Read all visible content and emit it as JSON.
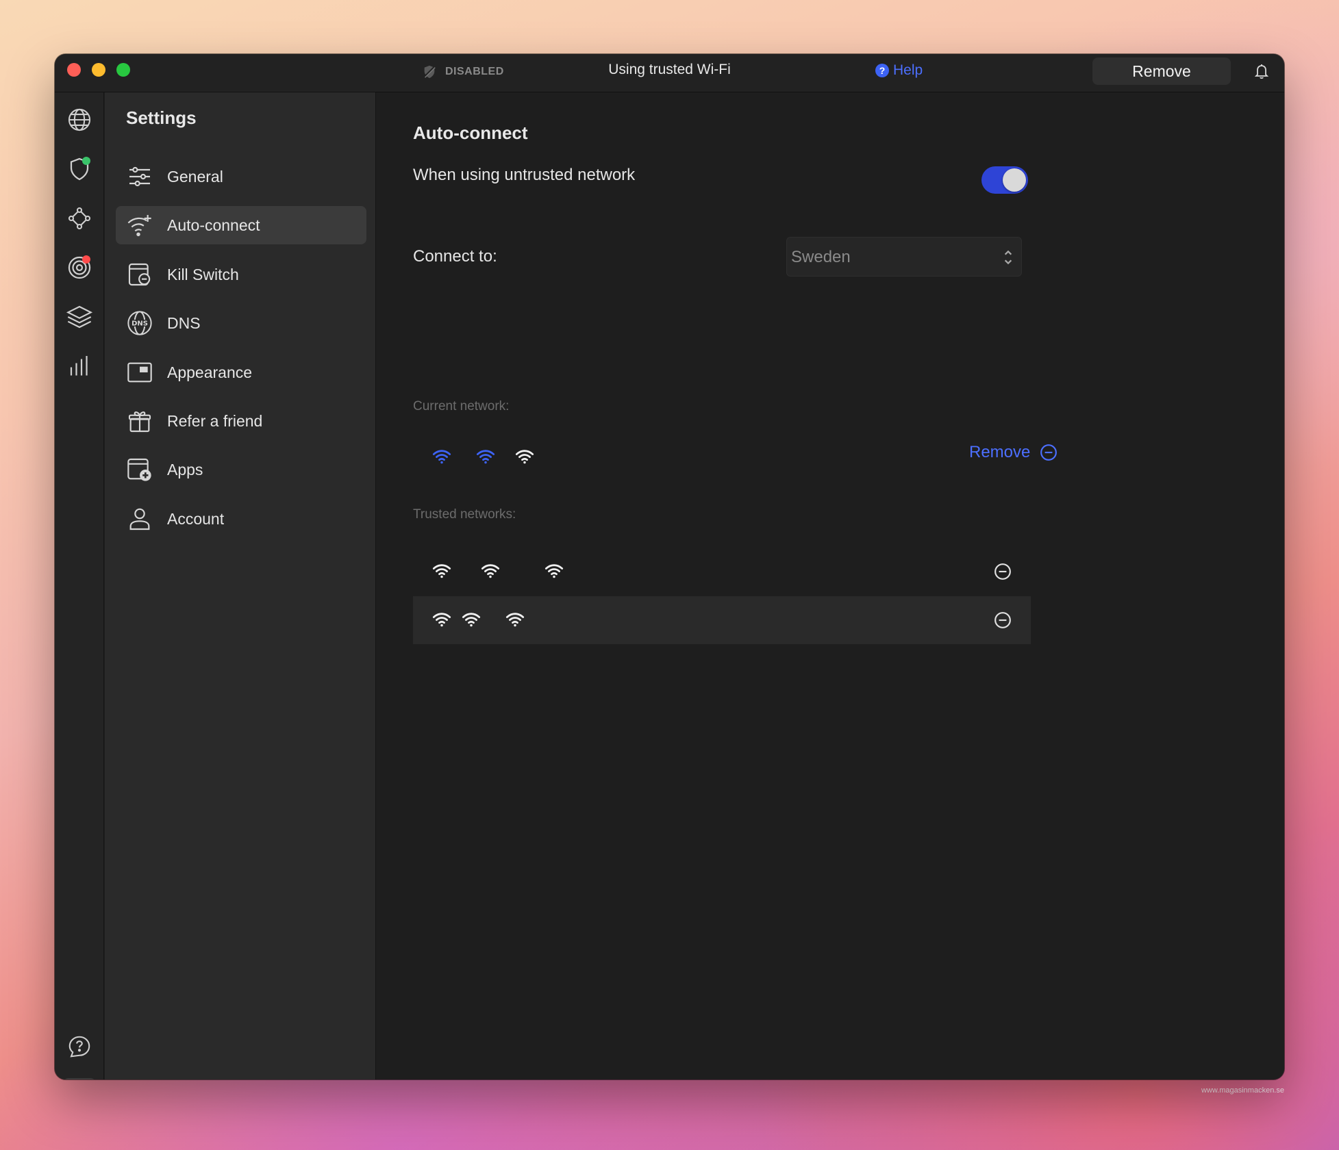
{
  "watermark": "www.magasinmacken.se",
  "titlebar": {
    "status_label": "DISABLED",
    "title": "Using trusted Wi-Fi",
    "help_label": "Help",
    "help_badge": "?",
    "remove_label": "Remove"
  },
  "rail": {
    "items": [
      {
        "icon": "globe-icon"
      },
      {
        "icon": "shield-icon",
        "dot": "#3ac46a"
      },
      {
        "icon": "nodes-icon"
      },
      {
        "icon": "target-icon",
        "dot": "#ff4b4b"
      },
      {
        "icon": "layers-icon"
      },
      {
        "icon": "stats-icon"
      }
    ],
    "bottom": [
      {
        "icon": "help-chat-icon"
      },
      {
        "icon": "gear-icon"
      }
    ]
  },
  "sidebar": {
    "title": "Settings",
    "items": [
      {
        "label": "General",
        "icon": "sliders-icon"
      },
      {
        "label": "Auto-connect",
        "icon": "wifi-sparkle-icon",
        "active": true
      },
      {
        "label": "Kill Switch",
        "icon": "kill-switch-icon"
      },
      {
        "label": "DNS",
        "icon": "dns-globe-icon"
      },
      {
        "label": "Appearance",
        "icon": "window-icon"
      },
      {
        "label": "Refer a friend",
        "icon": "gift-icon"
      },
      {
        "label": "Apps",
        "icon": "app-add-icon"
      },
      {
        "label": "Account",
        "icon": "person-icon"
      }
    ]
  },
  "main": {
    "section_title": "Auto-connect",
    "untrusted_label": "When using untrusted network",
    "untrusted_enabled": true,
    "connect_to_label": "Connect to:",
    "connect_to_value": "Sweden",
    "current_network_label": "Current network:",
    "current_remove_label": "Remove",
    "trusted_networks_label": "Trusted networks:"
  },
  "colors": {
    "accent": "#4c6fff",
    "toggle_on": "#2e44d6",
    "background": "#1e1e1e"
  }
}
